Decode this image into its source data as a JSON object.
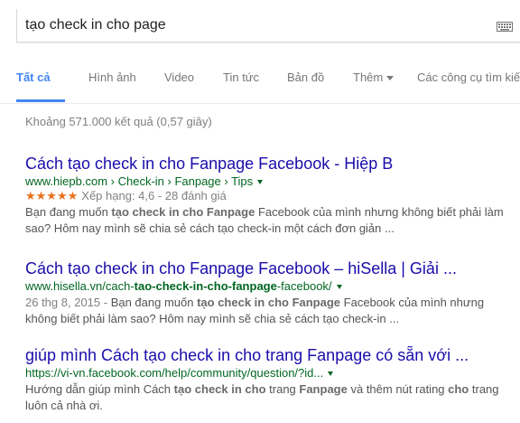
{
  "search": {
    "query": "tạo check in cho page"
  },
  "tabs": [
    {
      "label": "Tất cả"
    },
    {
      "label": "Hình ảnh"
    },
    {
      "label": "Video"
    },
    {
      "label": "Tin tức"
    },
    {
      "label": "Bản đồ"
    },
    {
      "label": "Thêm"
    },
    {
      "label": "Các công cụ tìm kiế"
    }
  ],
  "stats": "Khoảng 571.000 kết quả (0,57 giây)",
  "results": [
    {
      "title": "Cách tạo check in cho Fanpage Facebook - Hiệp B",
      "url": "www.hiepb.com › Check-in › Fanpage › Tips",
      "stars": "★★★★★",
      "rating": "Xếp hạng: 4,6 - 28 đánh giá",
      "snippet": [
        "Bạn đang muốn ",
        "tạo check in cho Fanpage",
        " Facebook của mình nhưng không biết phải làm sao? Hôm nay mình sẽ chia sẻ cách tạo check-in một cách đơn giản ..."
      ]
    },
    {
      "title": "Cách tạo check in cho Fanpage Facebook – hiSella | Giải ...",
      "url_parts": [
        "www.hisella.vn/cach-",
        "tao-check-in-cho-fanpage",
        "-facebook/"
      ],
      "date": "26 thg 8, 2015 - ",
      "snippet": [
        "Bạn đang muốn ",
        "tạo check in cho Fanpage",
        " Facebook của mình nhưng không biết phải làm sao? Hôm nay mình sẽ chia sẻ cách tạo check-in ..."
      ]
    },
    {
      "title": "giúp mình Cách tạo check in cho trang Fanpage có sẵn với ...",
      "url": "https://vi-vn.facebook.com/help/community/question/?id...",
      "snippet": [
        "Hướng dẫn giúp mình Cách ",
        "tạo check in cho",
        " trang ",
        "Fanpage",
        " và thêm nút rating ",
        "cho",
        " trang luôn cả nhà ơi."
      ]
    }
  ]
}
